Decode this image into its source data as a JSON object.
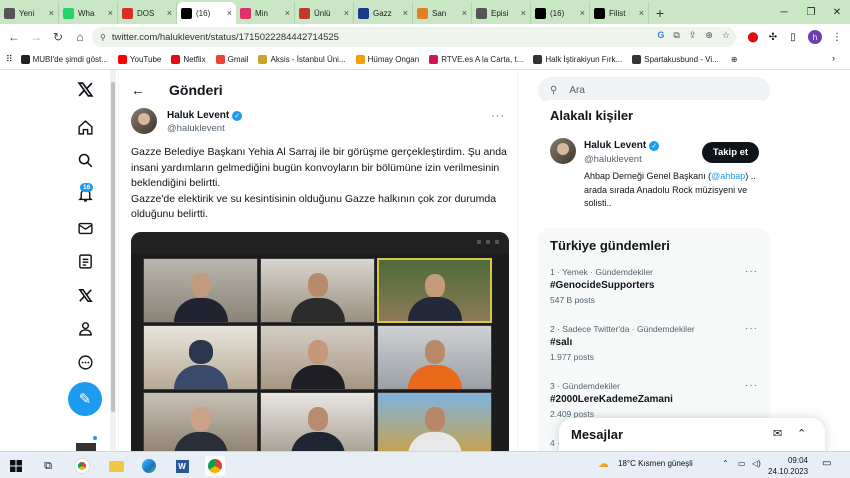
{
  "browser": {
    "tabs": [
      {
        "title": "Yeni",
        "color": "#555"
      },
      {
        "title": "Wha",
        "color": "#25d366"
      },
      {
        "title": "DOS",
        "color": "#d93025"
      },
      {
        "title": "(16)",
        "color": "#000"
      },
      {
        "title": "Min",
        "color": "#e1306c"
      },
      {
        "title": "Ünlü",
        "color": "#c0392b"
      },
      {
        "title": "Gazz",
        "color": "#1a3a8a"
      },
      {
        "title": "San",
        "color": "#e67e22"
      },
      {
        "title": "Episi",
        "color": "#555"
      },
      {
        "title": "(16)",
        "color": "#000"
      },
      {
        "title": "Filist",
        "color": "#000"
      }
    ],
    "url": "twitter.com/haluklevent/status/1715022284442714525",
    "bookmarks": [
      {
        "label": "MUBI'de şimdi göst...",
        "color": "#222"
      },
      {
        "label": "YouTube",
        "color": "#ff0000"
      },
      {
        "label": "Netflix",
        "color": "#e50914"
      },
      {
        "label": "Gmail",
        "color": "#ea4335"
      },
      {
        "label": "Aksis - İstanbul Üni...",
        "color": "#c9a227"
      },
      {
        "label": "Hümay Ongan",
        "color": "#f29f05"
      },
      {
        "label": "RTVE.es A la Carta, t...",
        "color": "#d4145a"
      },
      {
        "label": "Halk İştirakiyun Fırk...",
        "color": "#333"
      },
      {
        "label": "Spartakusbund - Vi...",
        "color": "#333"
      }
    ]
  },
  "nav": {
    "notifications_badge": "16"
  },
  "post": {
    "header": "Gönderi",
    "author_name": "Haluk Levent",
    "author_handle": "@haluklevent",
    "paragraph1": "Gazze Belediye Başkanı Yehia Al Sarraj ile bir görüşme gerçekleştirdim. Şu anda insani yardımların gelmediğini bugün konvoyların bir bölümüne izin verilmesinin beklendiğini belirtti.",
    "paragraph2": "Gazze'de elektirik ve su kesintisinin olduğunu Gazze halkının çok zor durumda olduğunu belirtti."
  },
  "right": {
    "search_placeholder": "Ara",
    "related_title": "Alakalı kişiler",
    "related": {
      "name": "Haluk Levent",
      "handle": "@haluklevent",
      "follow_label": "Takip et",
      "bio_prefix": "Ahbap Derneği Genel Başkanı (",
      "bio_link": "@ahbap",
      "bio_suffix": ") .. arada sırada Anadolu Rock müzisyeni ve solisti.."
    },
    "trends_title": "Türkiye gündemleri",
    "trends": [
      {
        "meta": "1 · Yemek · Gündemdekiler",
        "name": "#GenocideSupporters",
        "posts": "547 B posts"
      },
      {
        "meta": "2 · Sadece Twitter'da · Gündemdekiler",
        "name": "#salı",
        "posts": "1.977 posts"
      },
      {
        "meta": "3 · Gündemdekiler",
        "name": "#2000LereKademeZamani",
        "posts": "2.409 posts"
      },
      {
        "meta": "4 ·",
        "name": "",
        "posts": ""
      }
    ],
    "messages_title": "Mesajlar"
  },
  "taskbar": {
    "weather": "18°C  Kısmen güneşli",
    "time": "09:04",
    "date": "24.10.2023"
  },
  "colors": {
    "accent": "#1d9bf0",
    "tabstrip": "#c9e6c5",
    "dark": "#0f1419"
  }
}
